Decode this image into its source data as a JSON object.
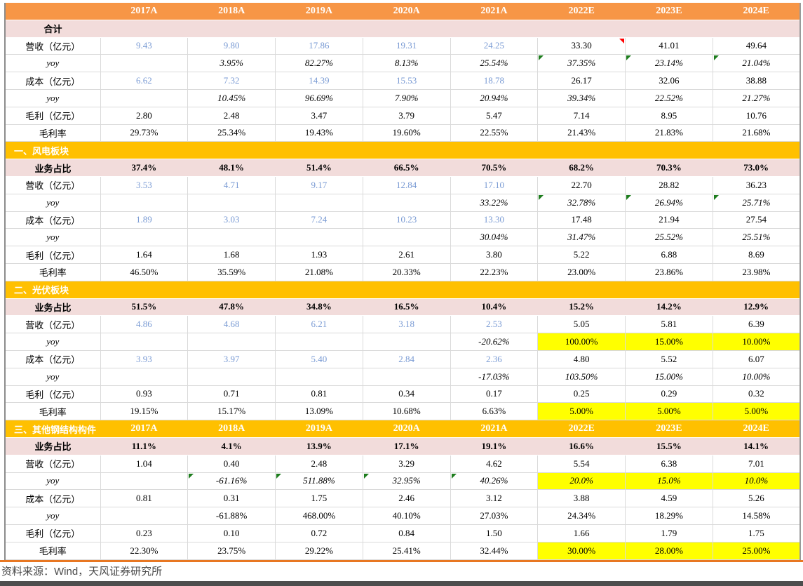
{
  "table": {
    "columns": [
      "2017A",
      "2018A",
      "2019A",
      "2020A",
      "2021A",
      "2022E",
      "2023E",
      "2024E"
    ],
    "sections": [
      {
        "title": "合计",
        "header_type": "pink",
        "show_years_in_header": false,
        "rows": [
          {
            "label": "营收（亿元）",
            "cells": [
              {
                "v": "9.43",
                "blue": true
              },
              {
                "v": "9.80",
                "blue": true
              },
              {
                "v": "17.86",
                "blue": true
              },
              {
                "v": "19.31",
                "blue": true
              },
              {
                "v": "24.25",
                "blue": true
              },
              {
                "v": "33.30",
                "marker": "red"
              },
              {
                "v": "41.01"
              },
              {
                "v": "49.64"
              }
            ]
          },
          {
            "label": "yoy",
            "label_italic": true,
            "cells_italic": true,
            "cells": [
              {
                "v": ""
              },
              {
                "v": "3.95%"
              },
              {
                "v": "82.27%"
              },
              {
                "v": "8.13%"
              },
              {
                "v": "25.54%"
              },
              {
                "v": "37.35%",
                "marker": "green"
              },
              {
                "v": "23.14%",
                "marker": "green"
              },
              {
                "v": "21.04%",
                "marker": "green"
              }
            ]
          },
          {
            "label": "成本（亿元）",
            "cells": [
              {
                "v": "6.62",
                "blue": true
              },
              {
                "v": "7.32",
                "blue": true
              },
              {
                "v": "14.39",
                "blue": true
              },
              {
                "v": "15.53",
                "blue": true
              },
              {
                "v": "18.78",
                "blue": true
              },
              {
                "v": "26.17"
              },
              {
                "v": "32.06"
              },
              {
                "v": "38.88"
              }
            ]
          },
          {
            "label": "yoy",
            "label_italic": true,
            "cells_italic": true,
            "cells": [
              {
                "v": ""
              },
              {
                "v": "10.45%"
              },
              {
                "v": "96.69%"
              },
              {
                "v": "7.90%"
              },
              {
                "v": "20.94%"
              },
              {
                "v": "39.34%"
              },
              {
                "v": "22.52%"
              },
              {
                "v": "21.27%"
              }
            ]
          },
          {
            "label": "毛利（亿元）",
            "cells": [
              {
                "v": "2.80"
              },
              {
                "v": "2.48"
              },
              {
                "v": "3.47"
              },
              {
                "v": "3.79"
              },
              {
                "v": "5.47"
              },
              {
                "v": "7.14"
              },
              {
                "v": "8.95"
              },
              {
                "v": "10.76"
              }
            ]
          },
          {
            "label": "毛利率",
            "cells": [
              {
                "v": "29.73%"
              },
              {
                "v": "25.34%"
              },
              {
                "v": "19.43%"
              },
              {
                "v": "19.60%"
              },
              {
                "v": "22.55%"
              },
              {
                "v": "21.43%"
              },
              {
                "v": "21.83%"
              },
              {
                "v": "21.68%"
              }
            ]
          }
        ]
      },
      {
        "title": "一、风电板块",
        "header_type": "gold",
        "show_years_in_header": false,
        "rows": [
          {
            "label": "业务占比",
            "share": true,
            "cells": [
              {
                "v": "37.4%"
              },
              {
                "v": "48.1%"
              },
              {
                "v": "51.4%"
              },
              {
                "v": "66.5%"
              },
              {
                "v": "70.5%"
              },
              {
                "v": "68.2%"
              },
              {
                "v": "70.3%"
              },
              {
                "v": "73.0%"
              }
            ]
          },
          {
            "label": "营收（亿元）",
            "cells": [
              {
                "v": "3.53",
                "blue": true
              },
              {
                "v": "4.71",
                "blue": true
              },
              {
                "v": "9.17",
                "blue": true
              },
              {
                "v": "12.84",
                "blue": true
              },
              {
                "v": "17.10",
                "blue": true
              },
              {
                "v": "22.70"
              },
              {
                "v": "28.82"
              },
              {
                "v": "36.23"
              }
            ]
          },
          {
            "label": "yoy",
            "label_italic": true,
            "cells_italic": true,
            "cells": [
              {
                "v": ""
              },
              {
                "v": ""
              },
              {
                "v": ""
              },
              {
                "v": ""
              },
              {
                "v": "33.22%"
              },
              {
                "v": "32.78%",
                "marker": "green"
              },
              {
                "v": "26.94%",
                "marker": "green"
              },
              {
                "v": "25.71%",
                "marker": "green"
              }
            ]
          },
          {
            "label": "成本（亿元）",
            "cells": [
              {
                "v": "1.89",
                "blue": true
              },
              {
                "v": "3.03",
                "blue": true
              },
              {
                "v": "7.24",
                "blue": true
              },
              {
                "v": "10.23",
                "blue": true
              },
              {
                "v": "13.30",
                "blue": true
              },
              {
                "v": "17.48"
              },
              {
                "v": "21.94"
              },
              {
                "v": "27.54"
              }
            ]
          },
          {
            "label": "yoy",
            "label_italic": true,
            "cells_italic": true,
            "cells": [
              {
                "v": ""
              },
              {
                "v": ""
              },
              {
                "v": ""
              },
              {
                "v": ""
              },
              {
                "v": "30.04%"
              },
              {
                "v": "31.47%"
              },
              {
                "v": "25.52%"
              },
              {
                "v": "25.51%"
              }
            ]
          },
          {
            "label": "毛利（亿元）",
            "cells": [
              {
                "v": "1.64"
              },
              {
                "v": "1.68"
              },
              {
                "v": "1.93"
              },
              {
                "v": "2.61"
              },
              {
                "v": "3.80"
              },
              {
                "v": "5.22"
              },
              {
                "v": "6.88"
              },
              {
                "v": "8.69"
              }
            ]
          },
          {
            "label": "毛利率",
            "cells": [
              {
                "v": "46.50%"
              },
              {
                "v": "35.59%"
              },
              {
                "v": "21.08%"
              },
              {
                "v": "20.33%"
              },
              {
                "v": "22.23%"
              },
              {
                "v": "23.00%"
              },
              {
                "v": "23.86%"
              },
              {
                "v": "23.98%"
              }
            ]
          }
        ]
      },
      {
        "title": "二、光伏板块",
        "header_type": "gold",
        "show_years_in_header": false,
        "rows": [
          {
            "label": "业务占比",
            "share": true,
            "cells": [
              {
                "v": "51.5%"
              },
              {
                "v": "47.8%"
              },
              {
                "v": "34.8%"
              },
              {
                "v": "16.5%"
              },
              {
                "v": "10.4%"
              },
              {
                "v": "15.2%"
              },
              {
                "v": "14.2%"
              },
              {
                "v": "12.9%"
              }
            ]
          },
          {
            "label": "营收（亿元）",
            "cells": [
              {
                "v": "4.86",
                "blue": true
              },
              {
                "v": "4.68",
                "blue": true
              },
              {
                "v": "6.21",
                "blue": true
              },
              {
                "v": "3.18",
                "blue": true
              },
              {
                "v": "2.53",
                "blue": true
              },
              {
                "v": "5.05"
              },
              {
                "v": "5.81"
              },
              {
                "v": "6.39"
              }
            ]
          },
          {
            "label": "yoy",
            "label_italic": true,
            "cells_italic": true,
            "cells": [
              {
                "v": ""
              },
              {
                "v": ""
              },
              {
                "v": ""
              },
              {
                "v": ""
              },
              {
                "v": "-20.62%"
              },
              {
                "v": "100.00%",
                "bg": true,
                "italic": false
              },
              {
                "v": "15.00%",
                "bg": true,
                "italic": false
              },
              {
                "v": "10.00%",
                "bg": true,
                "italic": false
              }
            ]
          },
          {
            "label": "成本（亿元）",
            "cells": [
              {
                "v": "3.93",
                "blue": true
              },
              {
                "v": "3.97",
                "blue": true
              },
              {
                "v": "5.40",
                "blue": true
              },
              {
                "v": "2.84",
                "blue": true
              },
              {
                "v": "2.36",
                "blue": true
              },
              {
                "v": "4.80"
              },
              {
                "v": "5.52"
              },
              {
                "v": "6.07"
              }
            ]
          },
          {
            "label": "yoy",
            "label_italic": true,
            "cells_italic": true,
            "cells": [
              {
                "v": ""
              },
              {
                "v": ""
              },
              {
                "v": ""
              },
              {
                "v": ""
              },
              {
                "v": "-17.03%"
              },
              {
                "v": "103.50%"
              },
              {
                "v": "15.00%"
              },
              {
                "v": "10.00%"
              }
            ]
          },
          {
            "label": "毛利（亿元）",
            "cells": [
              {
                "v": "0.93"
              },
              {
                "v": "0.71"
              },
              {
                "v": "0.81"
              },
              {
                "v": "0.34"
              },
              {
                "v": "0.17"
              },
              {
                "v": "0.25"
              },
              {
                "v": "0.29"
              },
              {
                "v": "0.32"
              }
            ]
          },
          {
            "label": "毛利率",
            "cells": [
              {
                "v": "19.15%"
              },
              {
                "v": "15.17%"
              },
              {
                "v": "13.09%"
              },
              {
                "v": "10.68%"
              },
              {
                "v": "6.63%"
              },
              {
                "v": "5.00%",
                "bg": true
              },
              {
                "v": "5.00%",
                "bg": true
              },
              {
                "v": "5.00%",
                "bg": true
              }
            ]
          }
        ]
      },
      {
        "title": "三、其他钢结构构件",
        "header_type": "gold",
        "show_years_in_header": true,
        "rows": [
          {
            "label": "业务占比",
            "share": true,
            "cells": [
              {
                "v": "11.1%"
              },
              {
                "v": "4.1%"
              },
              {
                "v": "13.9%"
              },
              {
                "v": "17.1%"
              },
              {
                "v": "19.1%"
              },
              {
                "v": "16.6%"
              },
              {
                "v": "15.5%"
              },
              {
                "v": "14.1%"
              }
            ]
          },
          {
            "label": "营收（亿元）",
            "cells": [
              {
                "v": "1.04"
              },
              {
                "v": "0.40"
              },
              {
                "v": "2.48"
              },
              {
                "v": "3.29"
              },
              {
                "v": "4.62"
              },
              {
                "v": "5.54"
              },
              {
                "v": "6.38"
              },
              {
                "v": "7.01"
              }
            ]
          },
          {
            "label": "yoy",
            "label_italic": true,
            "cells_italic": true,
            "cells": [
              {
                "v": ""
              },
              {
                "v": "-61.16%",
                "marker": "green"
              },
              {
                "v": "511.88%",
                "marker": "green"
              },
              {
                "v": "32.95%",
                "marker": "green"
              },
              {
                "v": "40.26%",
                "marker": "green"
              },
              {
                "v": "20.0%",
                "bg": true
              },
              {
                "v": "15.0%",
                "bg": true
              },
              {
                "v": "10.0%",
                "bg": true
              }
            ]
          },
          {
            "label": "成本（亿元）",
            "cells": [
              {
                "v": "0.81"
              },
              {
                "v": "0.31"
              },
              {
                "v": "1.75"
              },
              {
                "v": "2.46"
              },
              {
                "v": "3.12"
              },
              {
                "v": "3.88"
              },
              {
                "v": "4.59"
              },
              {
                "v": "5.26"
              }
            ]
          },
          {
            "label": "yoy",
            "label_italic": true,
            "cells_italic": false,
            "cells": [
              {
                "v": ""
              },
              {
                "v": "-61.88%"
              },
              {
                "v": "468.00%"
              },
              {
                "v": "40.10%"
              },
              {
                "v": "27.03%"
              },
              {
                "v": "24.34%"
              },
              {
                "v": "18.29%"
              },
              {
                "v": "14.58%"
              }
            ]
          },
          {
            "label": "毛利（亿元）",
            "cells": [
              {
                "v": "0.23"
              },
              {
                "v": "0.10"
              },
              {
                "v": "0.72"
              },
              {
                "v": "0.84"
              },
              {
                "v": "1.50"
              },
              {
                "v": "1.66"
              },
              {
                "v": "1.79"
              },
              {
                "v": "1.75"
              }
            ]
          },
          {
            "label": "毛利率",
            "cells": [
              {
                "v": "22.30%"
              },
              {
                "v": "23.75%"
              },
              {
                "v": "29.22%"
              },
              {
                "v": "25.41%"
              },
              {
                "v": "32.44%"
              },
              {
                "v": "30.00%",
                "bg": true
              },
              {
                "v": "28.00%",
                "bg": true
              },
              {
                "v": "25.00%",
                "bg": true
              }
            ]
          }
        ]
      }
    ]
  },
  "footer": {
    "source": "资料来源：Wind，天风证券研究所"
  },
  "colors": {
    "header_orange": "#F79646",
    "section_gold": "#FFC000",
    "row_pink": "#F2DCDB",
    "highlight_yellow": "#FFFF00",
    "blue_value_text": "#7A9BD4",
    "cell_border": "#DADADA",
    "divider_orange": "#E87722",
    "bottom_bar_gray": "#4D4D4D",
    "green_marker": "#1E7D1E",
    "red_marker": "#FF0000"
  }
}
